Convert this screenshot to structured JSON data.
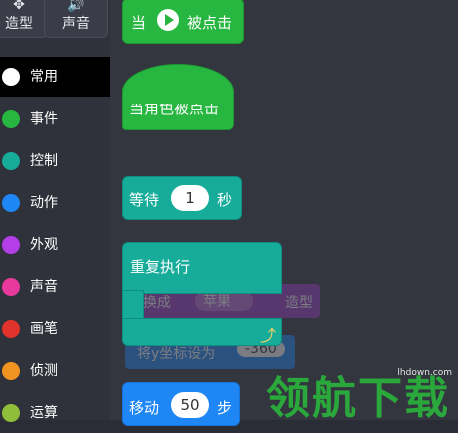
{
  "tabs": [
    {
      "label": "造型",
      "icon": "costume-icon"
    },
    {
      "label": "声音",
      "icon": "sound-icon"
    }
  ],
  "categories": [
    {
      "label": "常用",
      "color": "#ffffff",
      "selected": true
    },
    {
      "label": "事件",
      "color": "#27b640"
    },
    {
      "label": "控制",
      "color": "#17ab9a"
    },
    {
      "label": "动作",
      "color": "#1f86f5"
    },
    {
      "label": "外观",
      "color": "#b43ee8"
    },
    {
      "label": "声音",
      "color": "#e6399b"
    },
    {
      "label": "画笔",
      "color": "#e0332b"
    },
    {
      "label": "侦测",
      "color": "#f09321"
    },
    {
      "label": "运算",
      "color": "#8fbf3a"
    }
  ],
  "blocks": {
    "when_flag": {
      "prefix": "当",
      "suffix": "被点击"
    },
    "when_sprite_clicked": {
      "label": "当角色被点击"
    },
    "wait": {
      "prefix": "等待",
      "value": "1",
      "suffix": "秒"
    },
    "repeat_forever": {
      "label": "重复执行"
    },
    "move": {
      "prefix": "移动",
      "value": "50",
      "suffix": "步"
    }
  },
  "ghost_blocks": {
    "switch_costume": {
      "prefix": "换成",
      "value": "苹果",
      "suffix": "造型"
    },
    "set_y": {
      "label": "将y坐标设为",
      "value": "-360"
    }
  },
  "watermark": {
    "text": "领航下载",
    "url": "lhdown.com"
  }
}
